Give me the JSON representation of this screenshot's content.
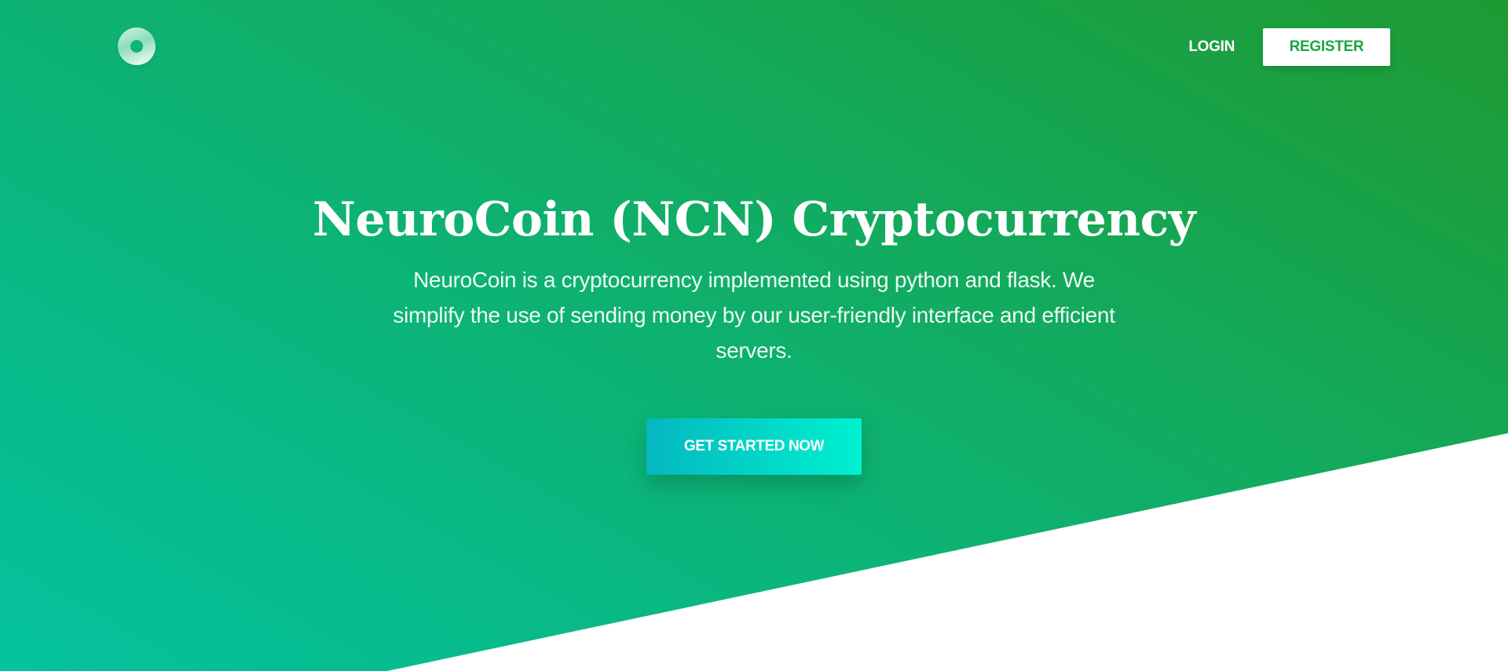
{
  "header": {
    "logo_icon": "neurocoin-logo-icon",
    "login_label": "LOGIN",
    "register_label": "REGISTER"
  },
  "hero": {
    "title": "NeuroCoin (NCN) Cryptocurrency",
    "description": "NeuroCoin is a cryptocurrency implemented using python and flask. We simplify the use of sending money by our user-friendly interface and efficient servers.",
    "cta_label": "GET STARTED NOW"
  },
  "colors": {
    "gradient_start": "#04c29f",
    "gradient_end": "#1e9a32",
    "register_text": "#18a83a",
    "cta_start": "#04b8bf",
    "cta_end": "#00f0d0"
  }
}
